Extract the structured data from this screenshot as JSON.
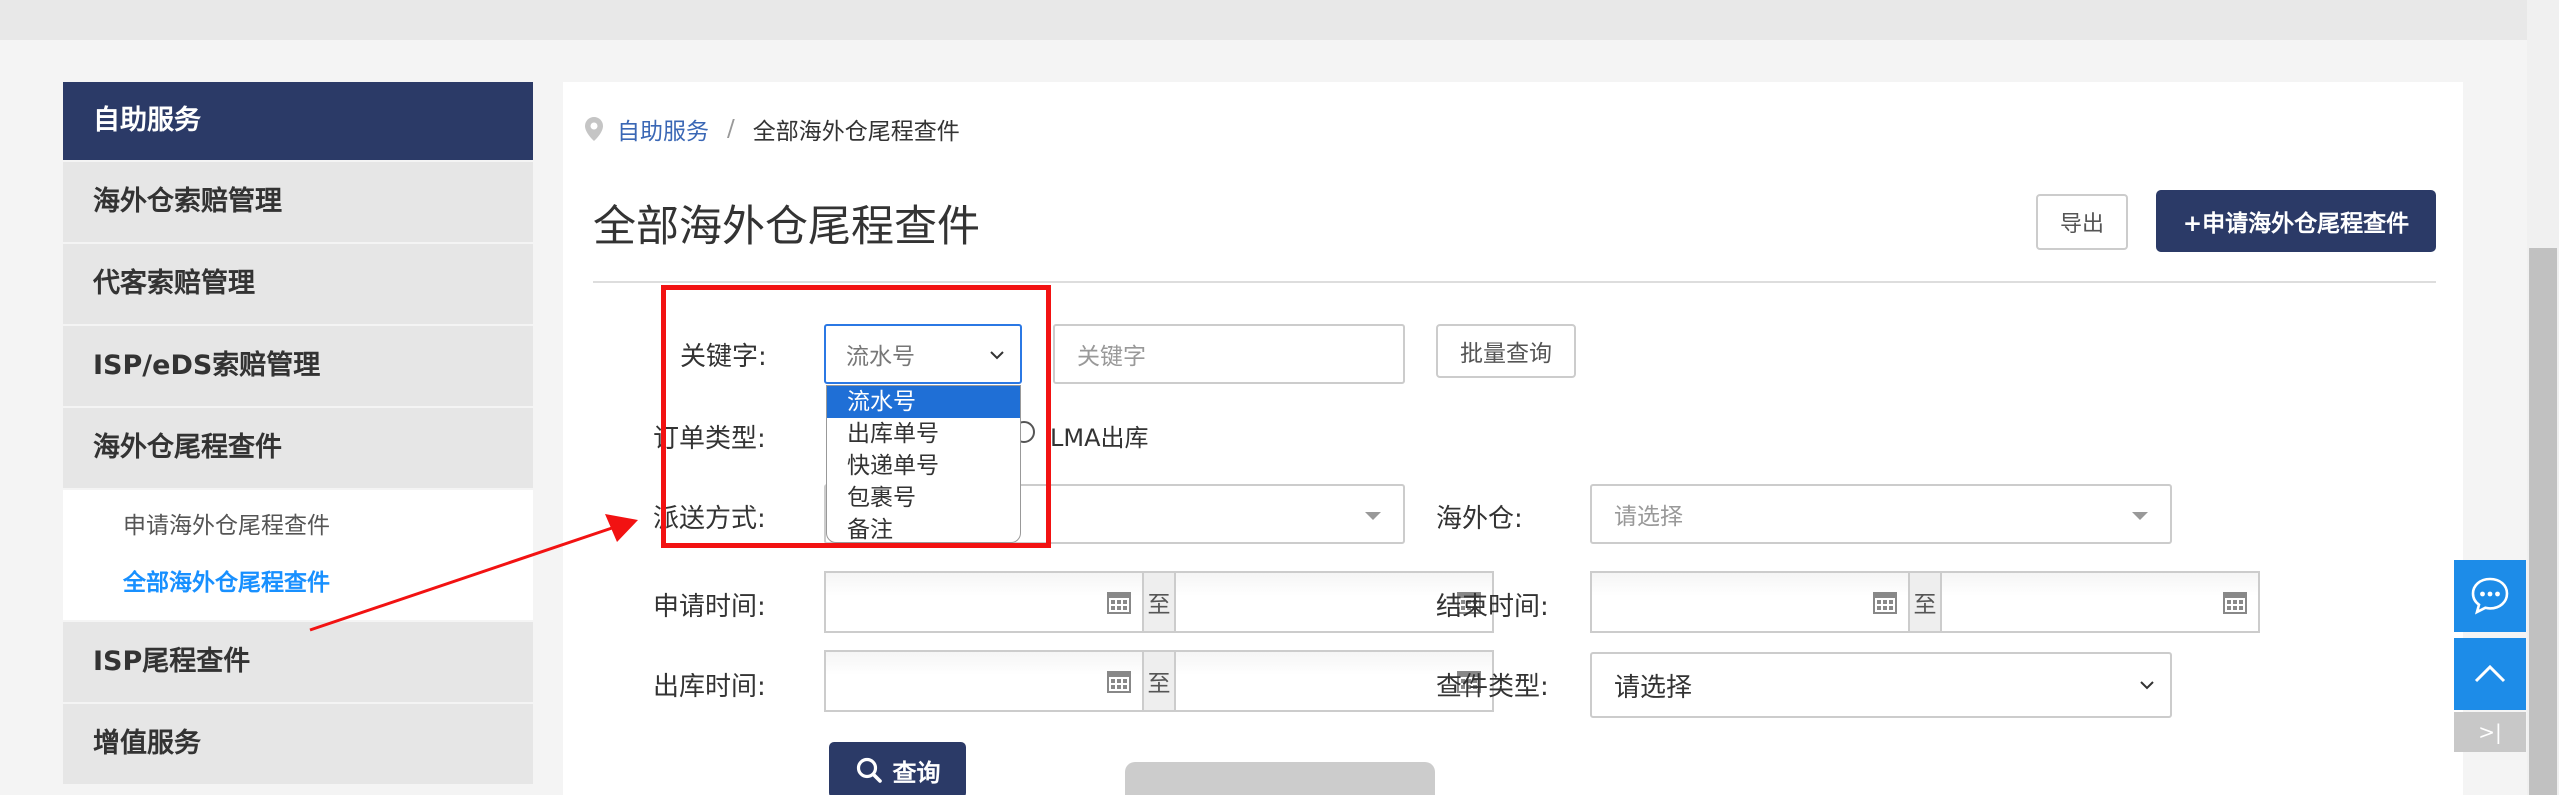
{
  "sidebar": {
    "header": "自助服务",
    "items": [
      {
        "label": "海外仓索赔管理"
      },
      {
        "label": "代客索赔管理"
      },
      {
        "label": "ISP/eDS索赔管理"
      },
      {
        "label": "海外仓尾程查件"
      }
    ],
    "sub_items": [
      {
        "label": "申请海外仓尾程查件"
      },
      {
        "label": "全部海外仓尾程查件"
      }
    ],
    "items_after": [
      {
        "label": "ISP尾程查件"
      },
      {
        "label": "增值服务"
      }
    ]
  },
  "breadcrumb": {
    "root": "自助服务",
    "separator": "/",
    "current": "全部海外仓尾程查件"
  },
  "page": {
    "title": "全部海外仓尾程查件",
    "export_label": "导出",
    "apply_label": "+申请海外仓尾程查件"
  },
  "filters": {
    "keyword_label": "关键字:",
    "keyword_type_value": "流水号",
    "keyword_placeholder": "关键字",
    "batch_query_label": "批量查询",
    "order_type_label": "订单类型:",
    "order_type_option": "LMA出库",
    "delivery_label": "派送方式:",
    "warehouse_label": "海外仓:",
    "warehouse_placeholder": "请选择",
    "apply_time_label": "申请时间:",
    "end_time_label": "结束时间:",
    "outbound_time_label": "出库时间:",
    "range_separator": "至",
    "query_type_label": "查件类型:",
    "query_type_value": "请选择",
    "query_button": "查询"
  },
  "keyword_dropdown": {
    "options": [
      "流水号",
      "出库单号",
      "快递单号",
      "包裹号",
      "备注"
    ],
    "selected": "流水号"
  },
  "float_panel": {
    "collapse_label": ">|"
  },
  "colors": {
    "primary_navy": "#2b3a67",
    "link_blue": "#3a67b5",
    "active_blue": "#1890ff",
    "highlight_red": "#f21212",
    "float_blue": "#1d8ce8"
  }
}
